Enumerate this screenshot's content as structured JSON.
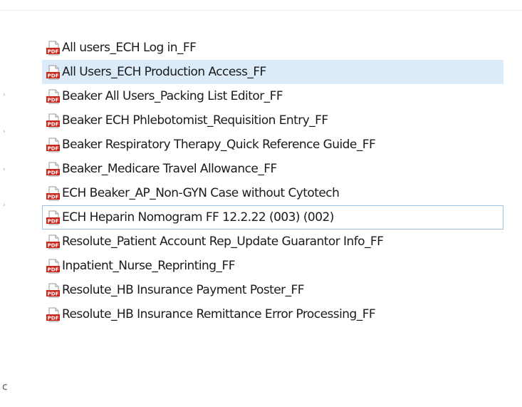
{
  "files": [
    {
      "name": "All users_ECH Log in_FF",
      "icon": "pdf-icon",
      "state": "normal"
    },
    {
      "name": "All Users_ECH Production Access_FF",
      "icon": "pdf-icon",
      "state": "hover"
    },
    {
      "name": "Beaker All Users_Packing List Editor_FF",
      "icon": "pdf-icon",
      "state": "normal"
    },
    {
      "name": "Beaker ECH Phlebotomist_Requisition Entry_FF",
      "icon": "pdf-icon",
      "state": "normal"
    },
    {
      "name": "Beaker Respiratory Therapy_Quick Reference Guide_FF",
      "icon": "pdf-icon",
      "state": "normal"
    },
    {
      "name": "Beaker_Medicare Travel Allowance_FF",
      "icon": "pdf-icon",
      "state": "normal"
    },
    {
      "name": "ECH Beaker_AP_Non-GYN Case without Cytotech",
      "icon": "pdf-icon",
      "state": "normal"
    },
    {
      "name": "ECH Heparin Nomogram FF 12.2.22 (003) (002)",
      "icon": "pdf-icon",
      "state": "focused"
    },
    {
      "name": "Resolute_Patient Account Rep_Update Guarantor Info_FF",
      "icon": "pdf-icon",
      "state": "normal"
    },
    {
      "name": "Inpatient_Nurse_Reprinting_FF",
      "icon": "pdf-icon",
      "state": "normal"
    },
    {
      "name": "Resolute_HB Insurance Payment Poster_FF",
      "icon": "pdf-icon",
      "state": "normal"
    },
    {
      "name": "Resolute_HB Insurance Remittance Error Processing_FF",
      "icon": "pdf-icon",
      "state": "normal"
    }
  ],
  "icon_badge_text": "PDF",
  "colors": {
    "hover_background": "#dcebf9",
    "focus_border": "#99c1e6",
    "pdf_red": "#c8281e"
  }
}
